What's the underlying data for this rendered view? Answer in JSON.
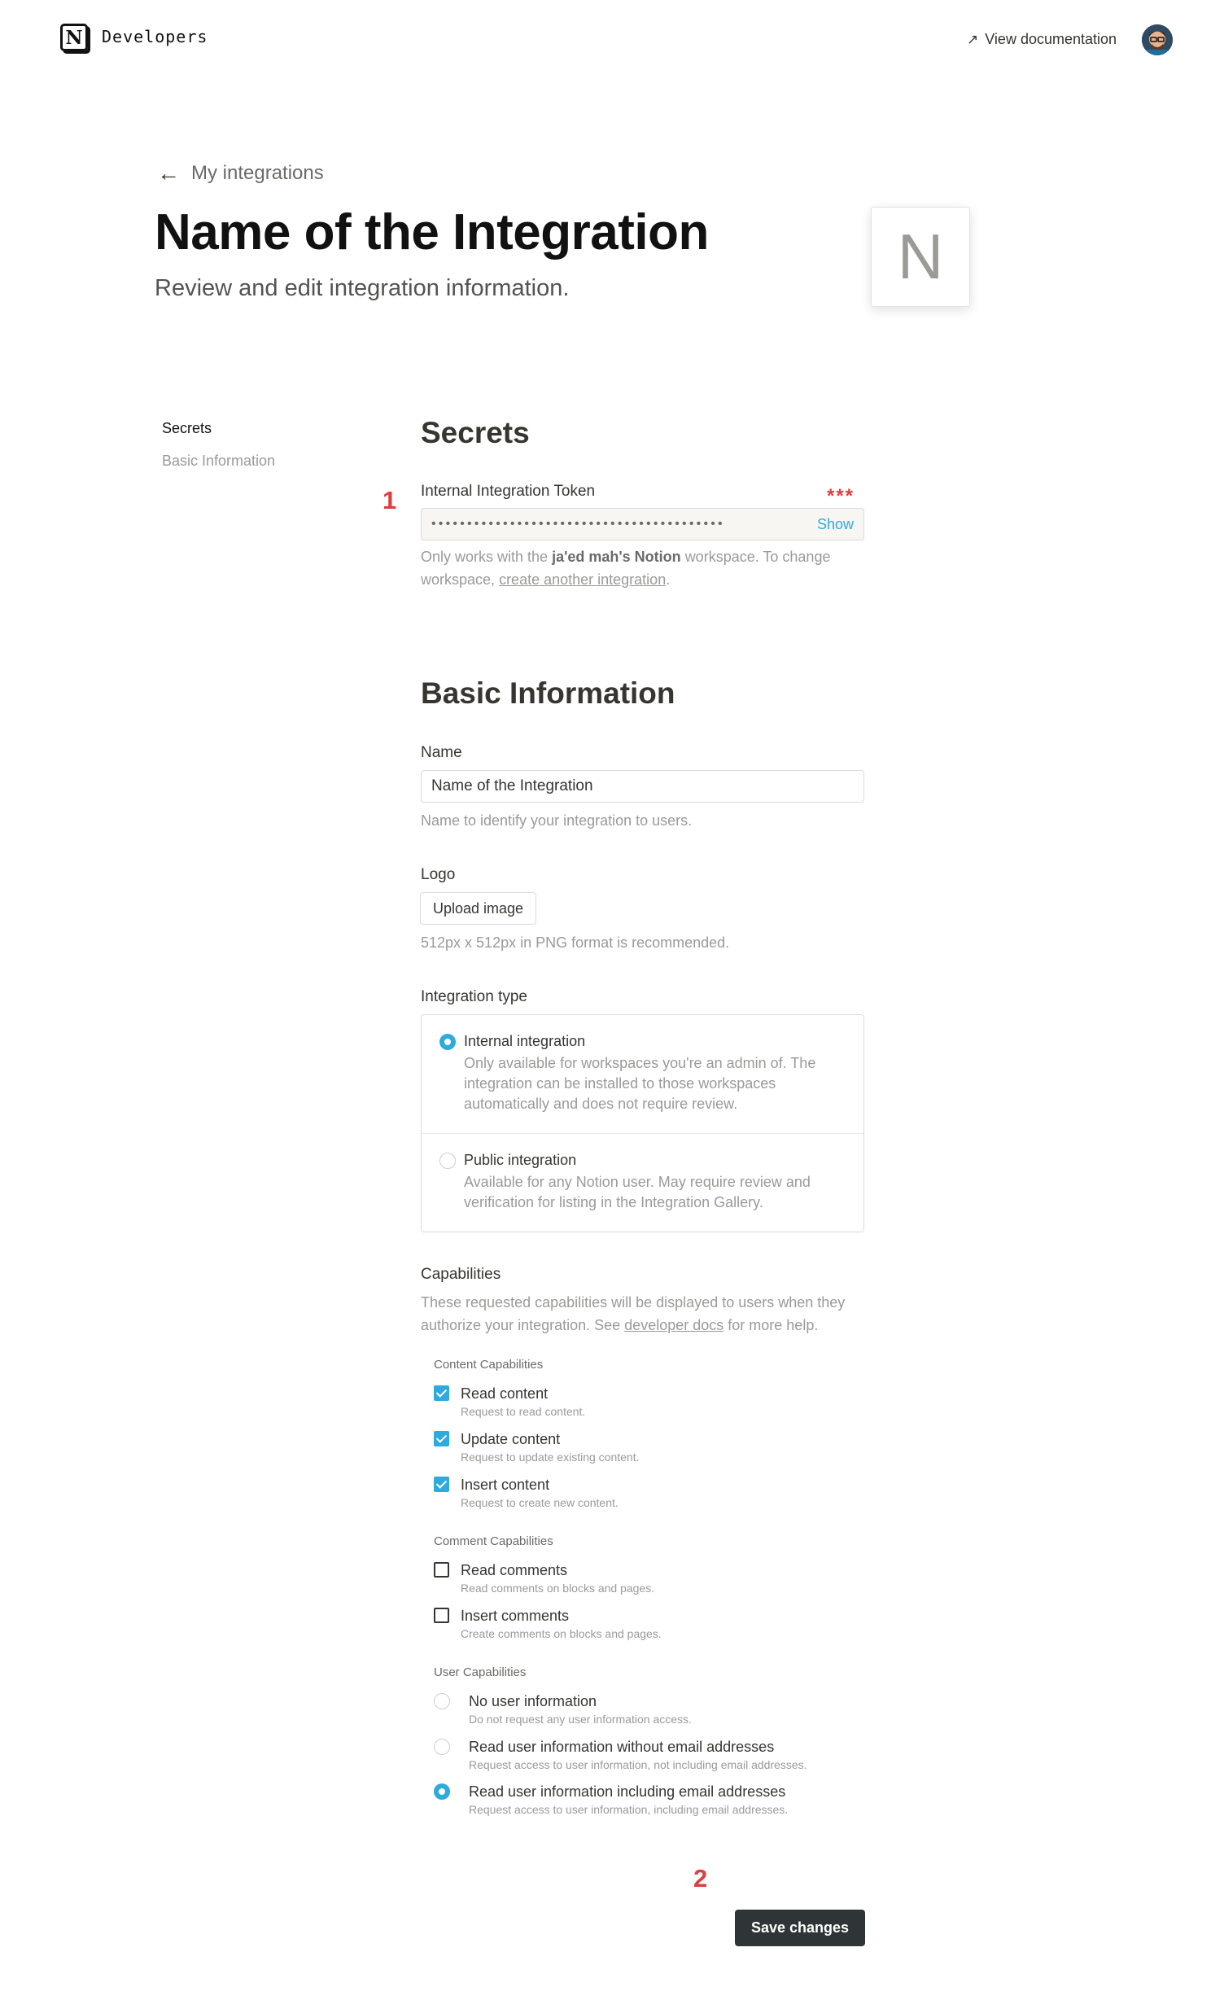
{
  "header": {
    "logo_letter": "N",
    "title": "Developers",
    "view_docs": "View documentation",
    "view_docs_icon": "arrow-up-right-icon",
    "avatar_icon": "user-avatar"
  },
  "hero": {
    "back_label": "My integrations",
    "back_icon": "arrow-left-icon",
    "title": "Name of the Integration",
    "subtitle": "Review and edit integration information.",
    "logo_letter": "N"
  },
  "sidenav": {
    "items": [
      {
        "label": "Secrets",
        "active": true
      },
      {
        "label": "Basic Information",
        "active": false
      }
    ]
  },
  "annotations": {
    "marker_1": "1",
    "marker_2": "2",
    "stars": "***",
    "color": "#e03e3e"
  },
  "secrets": {
    "heading": "Secrets",
    "token_label": "Internal Integration Token",
    "token_mask": "•••••••••••••••••••••••••••••••••••••••••",
    "show_label": "Show",
    "hint_pre": "Only works with the",
    "workspace": "ja'ed mah's Notion",
    "hint_mid": "workspace. To change workspace,",
    "hint_link": "create another integration",
    "hint_post": "."
  },
  "basic": {
    "heading": "Basic Information",
    "name_label": "Name",
    "name_value": "Name of the Integration",
    "name_hint": "Name to identify your integration to users.",
    "logo_label": "Logo",
    "upload_label": "Upload image",
    "logo_hint": "512px x 512px in PNG format is recommended.",
    "type_label": "Integration type",
    "types": [
      {
        "title": "Internal integration",
        "desc": "Only available for workspaces you're an admin of. The integration can be installed to those workspaces automatically and does not require review.",
        "selected": true
      },
      {
        "title": "Public integration",
        "desc": "Available for any Notion user. May require review and verification for listing in the Integration Gallery.",
        "selected": false
      }
    ]
  },
  "capabilities": {
    "heading": "Capabilities",
    "desc_pre": "These requested capabilities will be displayed to users when they authorize your integration. See",
    "desc_link": "developer docs",
    "desc_post": "for more help.",
    "content_group": "Content Capabilities",
    "content": [
      {
        "title": "Read content",
        "desc": "Request to read content.",
        "checked": true
      },
      {
        "title": "Update content",
        "desc": "Request to update existing content.",
        "checked": true
      },
      {
        "title": "Insert content",
        "desc": "Request to create new content.",
        "checked": true
      }
    ],
    "comment_group": "Comment Capabilities",
    "comments": [
      {
        "title": "Read comments",
        "desc": "Read comments on blocks and pages.",
        "checked": false
      },
      {
        "title": "Insert comments",
        "desc": "Create comments on blocks and pages.",
        "checked": false
      }
    ],
    "user_group": "User Capabilities",
    "users": [
      {
        "title": "No user information",
        "desc": "Do not request any user information access.",
        "selected": false
      },
      {
        "title": "Read user information without email addresses",
        "desc": "Request access to user information, not including email addresses.",
        "selected": false
      },
      {
        "title": "Read user information including email addresses",
        "desc": "Request access to user information, including email addresses.",
        "selected": true
      }
    ]
  },
  "actions": {
    "save_label": "Save changes"
  },
  "colors": {
    "accent": "#2eaadc",
    "button_dark": "#2f3437"
  }
}
